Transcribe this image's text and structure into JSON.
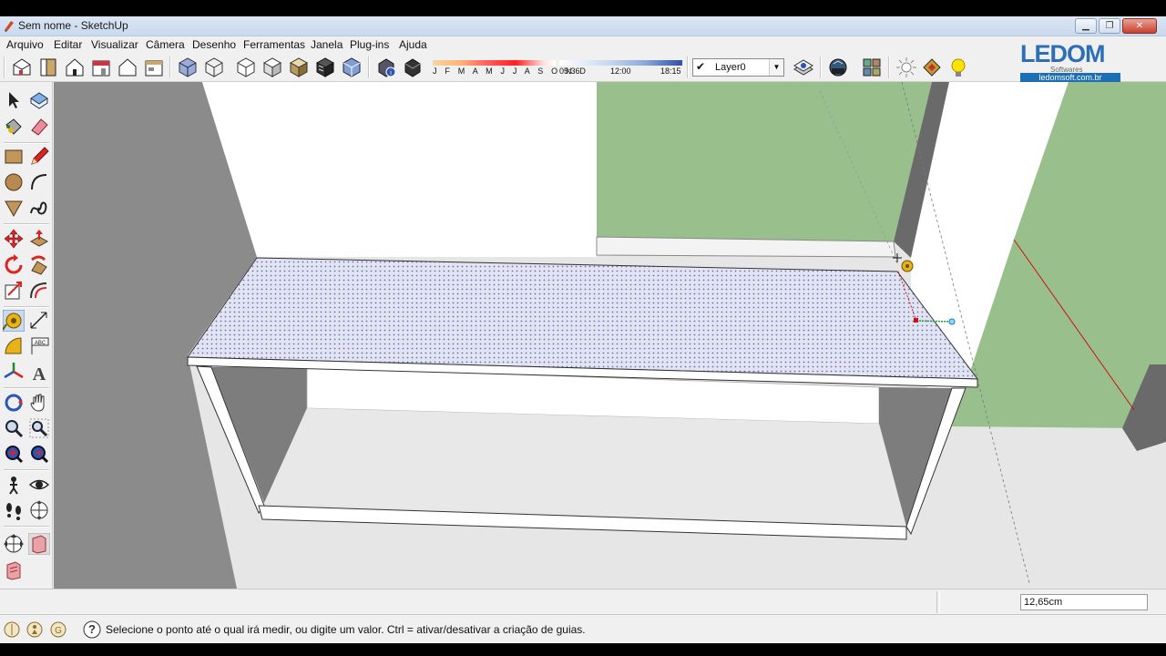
{
  "window": {
    "title": "Sem nome - SketchUp",
    "minimize_glyph": "▁",
    "maximize_glyph": "❐",
    "close_glyph": "✕"
  },
  "menu": {
    "items": [
      "Arquivo",
      "Editar",
      "Visualizar",
      "Câmera",
      "Desenho",
      "Ferramentas",
      "Janela",
      "Plug-ins",
      "Ajuda"
    ]
  },
  "toolbar": {
    "views": [
      "iso-view-icon",
      "top-view-icon",
      "front-view-icon",
      "right-view-icon",
      "back-view-icon",
      "left-view-icon"
    ],
    "styles": [
      "xray-icon",
      "wireframe-icon",
      "hidden-line-icon",
      "shaded-icon",
      "shaded-textures-icon",
      "monochrome-icon"
    ],
    "shadow": {
      "months": "J F M A M J J A S O N D",
      "time_start": "05:36",
      "time_mid": "12:00",
      "time_end": "18:15"
    },
    "layer": {
      "check_glyph": "✔",
      "name": "Layer0",
      "drop_glyph": "▼"
    }
  },
  "logo": {
    "main": "LEDOM",
    "sub": "Softwares",
    "url": "ledomsoft.com.br"
  },
  "measurements": {
    "value": "12,65cm"
  },
  "status": {
    "help_glyph": "?",
    "text": "Selecione o ponto até o qual irá medir, ou digite um valor. Ctrl = ativar/desativar a criação de guias."
  },
  "colors": {
    "titlebar": "#c9d9ee",
    "chrome": "#f0f0f0",
    "wall_green": "#99bf8c",
    "wall_grey": "#8b8b8b",
    "countertop": "#dfe0f0",
    "guide_red": "#d01010"
  }
}
